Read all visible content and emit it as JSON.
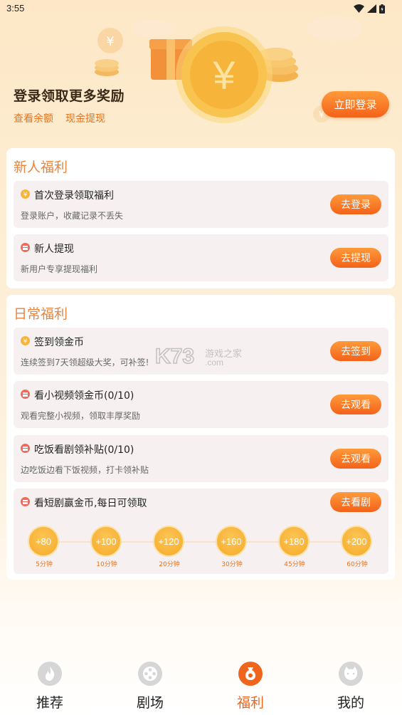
{
  "status_bar": {
    "time": "3:55"
  },
  "banner": {
    "title": "登录领取更多奖励",
    "link_balance": "查看余额",
    "link_withdraw": "现金提现",
    "login_button": "立即登录"
  },
  "new_user": {
    "title": "新人福利",
    "tasks": [
      {
        "title": "首次登录领取福利",
        "desc": "登录账户，收藏记录不丢失",
        "button": "去登录",
        "icon": "coin-icon"
      },
      {
        "title": "新人提现",
        "desc": "新用户专享提现福利",
        "button": "去提现",
        "icon": "gift-icon"
      }
    ]
  },
  "daily": {
    "title": "日常福利",
    "tasks": [
      {
        "title": "签到领金币",
        "desc": "连续签到7天领超级大奖，可补签!",
        "button": "去签到",
        "icon": "coin-icon"
      },
      {
        "title": "看小视频领金币(0/10)",
        "desc": "观看完整小视频，领取丰厚奖励",
        "button": "去观看",
        "icon": "gift-icon"
      },
      {
        "title": "吃饭看剧领补贴(0/10)",
        "desc": "边吃饭边看下饭视频，打卡领补贴",
        "button": "去观看",
        "icon": "gift-icon"
      },
      {
        "title": "看短剧赢金币,每日可领取",
        "button": "去看剧",
        "icon": "gift-icon"
      }
    ],
    "steps": [
      {
        "reward": "+80",
        "time": "5分钟"
      },
      {
        "reward": "+100",
        "time": "10分钟"
      },
      {
        "reward": "+120",
        "time": "20分钟"
      },
      {
        "reward": "+160",
        "time": "30分钟"
      },
      {
        "reward": "+180",
        "time": "45分钟"
      },
      {
        "reward": "+200",
        "time": "60分钟"
      }
    ]
  },
  "watermark": {
    "line1": "游戏之家",
    "line2": ".com",
    "logo": "K73"
  },
  "nav": {
    "items": [
      {
        "label": "推荐",
        "icon": "flame-icon"
      },
      {
        "label": "剧场",
        "icon": "film-reel-icon"
      },
      {
        "label": "福利",
        "icon": "money-bag-icon"
      },
      {
        "label": "我的",
        "icon": "face-icon"
      }
    ],
    "active_index": 2
  },
  "colors": {
    "accent": "#f4621a",
    "accent_light": "#ff9a3a",
    "section_title": "#e8853e",
    "coin": "#f6a92a"
  }
}
